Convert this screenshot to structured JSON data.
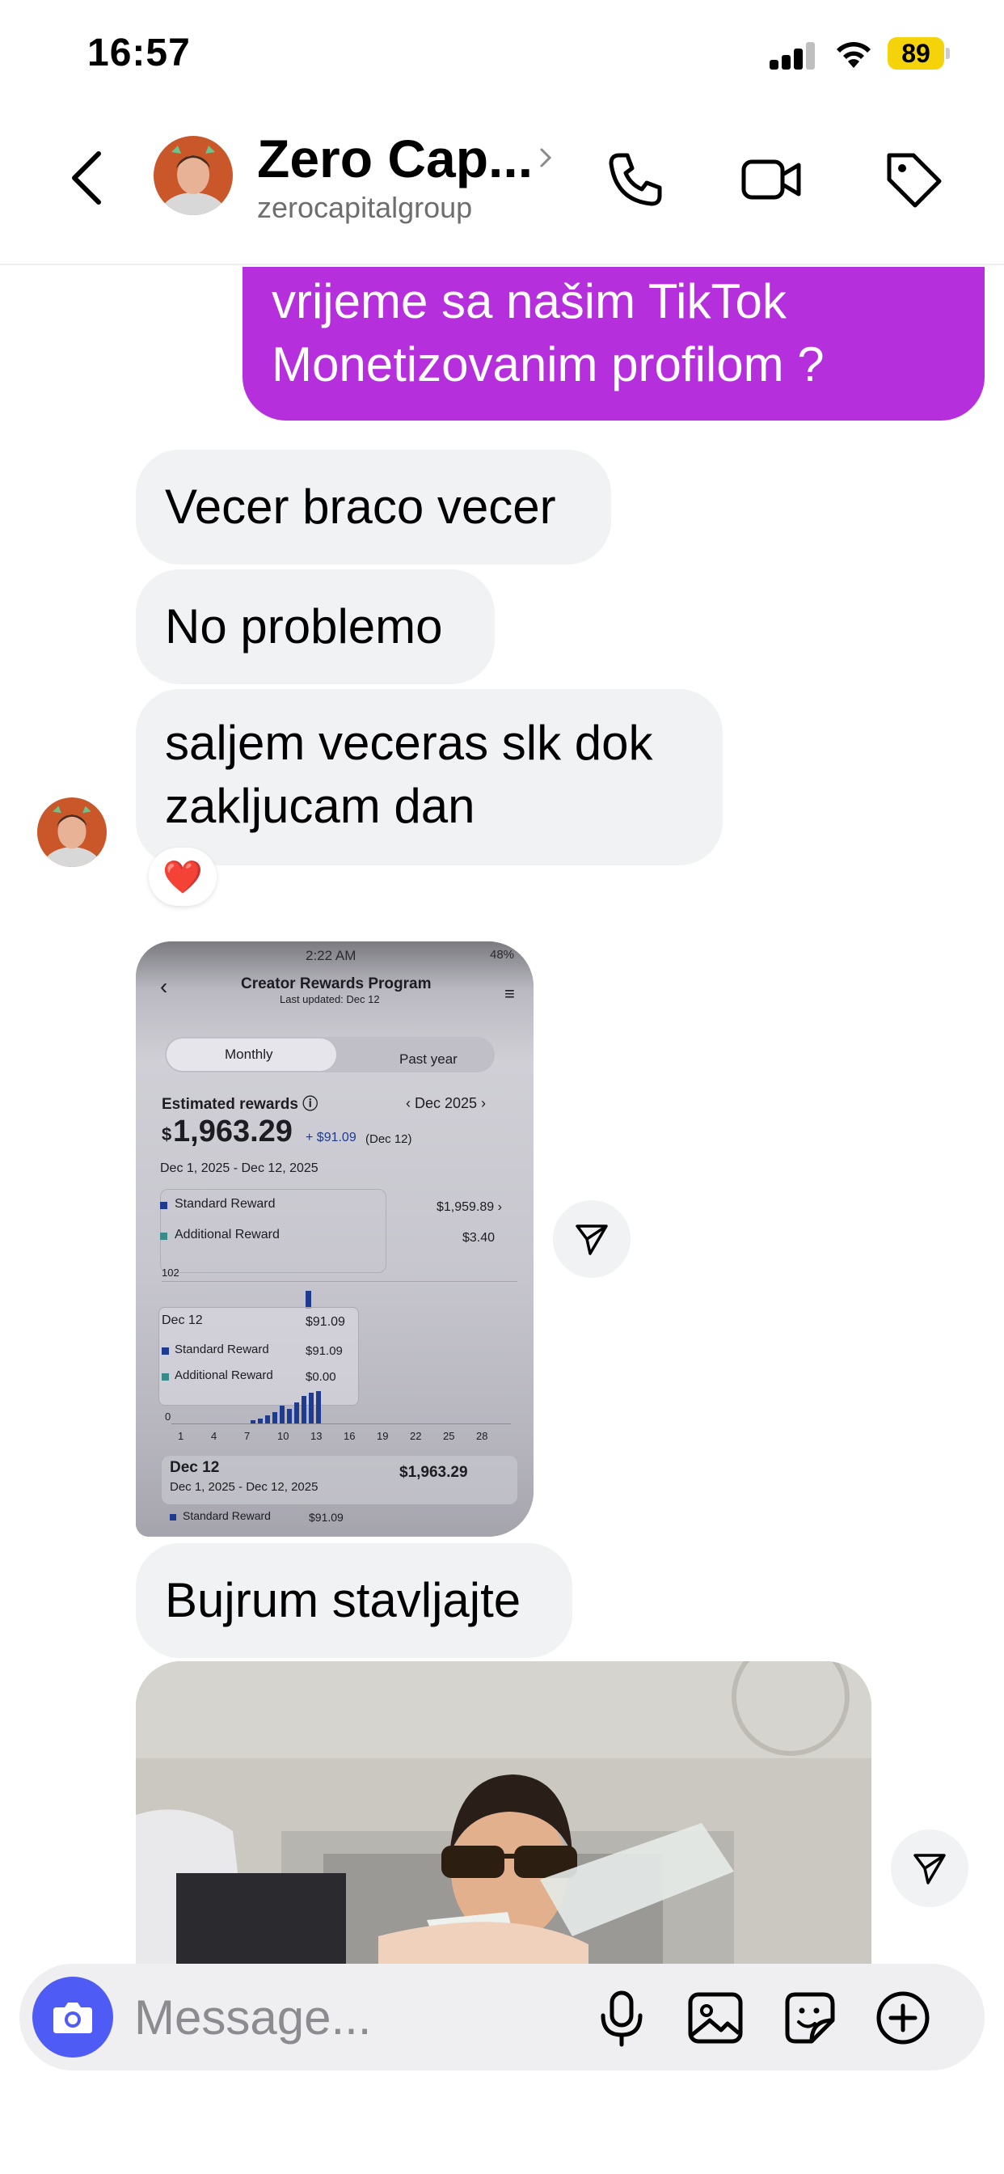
{
  "status_bar": {
    "time": "16:57",
    "battery": "89"
  },
  "header": {
    "name": "Zero Cap...",
    "handle": "zerocapitalgroup"
  },
  "messages": {
    "outgoing_line1": "vrijeme sa našim TikTok",
    "outgoing_line2": "Monetizovanim profilom ?",
    "in1": "Vecer braco vecer",
    "in2": "No problemo",
    "in3_line1": "saljem veceras slk dok",
    "in3_line2": "zakljucam dan",
    "reaction": "❤️",
    "in4": "Bujrum stavljajte"
  },
  "screenshot": {
    "time": "2:22 AM",
    "battery": "48%",
    "title": "Creator Rewards Program",
    "updated": "Last updated: Dec 12",
    "tab_monthly": "Monthly",
    "tab_past_year": "Past year",
    "est_label": "Estimated rewards ⓘ",
    "month_selector": "‹ Dec 2025 ›",
    "total_currency": "$",
    "total": "1,963.29",
    "delta": "+ $91.09",
    "delta_date": "(Dec 12)",
    "range": "Dec 1, 2025 - Dec 12, 2025",
    "standard_label": "Standard Reward",
    "standard_value": "$1,959.89 ›",
    "additional_label": "Additional Reward",
    "additional_value": "$3.40",
    "axis_top": "102",
    "axis_zero": "0",
    "tooltip_date": "Dec 12",
    "tooltip_total": "$91.09",
    "tooltip_standard_label": "Standard Reward",
    "tooltip_standard_value": "$91.09",
    "tooltip_additional_label": "Additional Reward",
    "tooltip_additional_value": "$0.00",
    "x_ticks": [
      "1",
      "4",
      "7",
      "10",
      "13",
      "16",
      "19",
      "22",
      "25",
      "28"
    ],
    "footer_date": "Dec 12",
    "footer_total": "$1,963.29",
    "footer_range": "Dec 1, 2025 - Dec 12, 2025",
    "footer_std_label": "Standard Reward",
    "footer_std_value": "$91.09"
  },
  "composer": {
    "placeholder": "Message..."
  },
  "colors": {
    "outgoing_bubble": "#b52fdc",
    "incoming_bubble": "#f1f2f4",
    "camera_button": "#4f5bf5",
    "battery": "#f5d30a"
  },
  "icons": [
    "back-icon",
    "chevron-right-icon",
    "phone-icon",
    "video-call-icon",
    "tag-icon",
    "share-icon",
    "camera-icon",
    "microphone-icon",
    "gallery-icon",
    "sticker-icon",
    "plus-icon",
    "heart-icon"
  ]
}
